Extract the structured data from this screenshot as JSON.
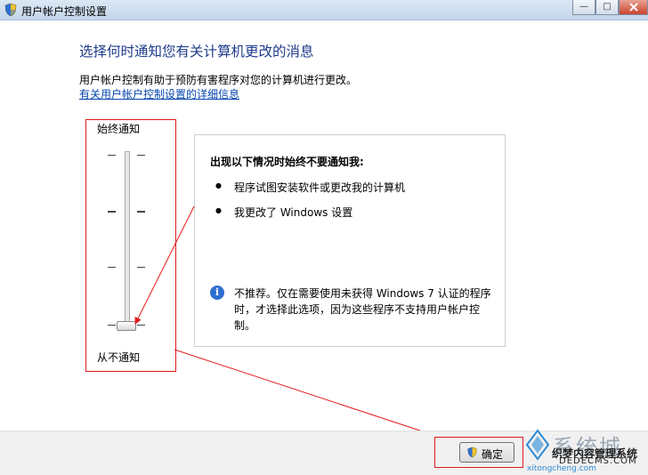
{
  "window": {
    "title": "用户帐户控制设置",
    "minimize_label": "—",
    "maximize_label": "□"
  },
  "main": {
    "heading": "选择何时通知您有关计算机更改的消息",
    "description": "用户帐户控制有助于预防有害程序对您的计算机进行更改。",
    "link": "有关用户帐户控制设置的详细信息"
  },
  "slider": {
    "top_label": "始终通知",
    "bottom_label": "从不通知",
    "levels": 4,
    "selected_level": 1
  },
  "panel": {
    "title": "出现以下情况时始终不要通知我:",
    "bullets": [
      "程序试图安装软件或更改我的计算机",
      "我更改了 Windows 设置"
    ],
    "bullet_char": "●",
    "info_icon": "i",
    "info_text": "不推荐。仅在需要使用未获得 Windows 7 认证的程序时，才选择此选项，因为这些程序不支持用户帐户控制。"
  },
  "footer": {
    "ok_label": "确定"
  },
  "watermark": {
    "main": "系统城",
    "sub": "织梦内容管理系统",
    "url": "DEDECMS.COM",
    "url2": "xitongcheng.com"
  },
  "colors": {
    "heading": "#1e3a8a",
    "link": "#0645ad",
    "annotation": "#e0191c",
    "info_icon": "#2f6fcf"
  }
}
